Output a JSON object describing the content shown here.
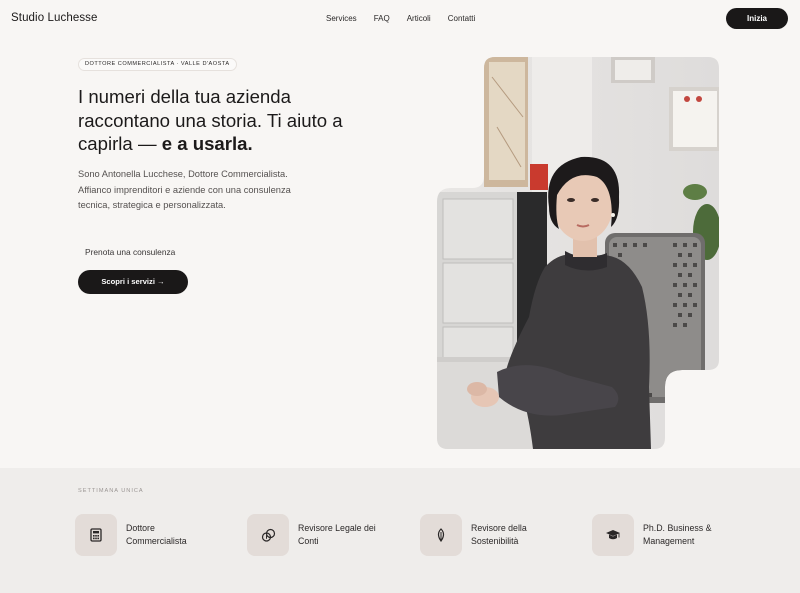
{
  "nav": {
    "brand": "Studio Luchesse",
    "links": [
      "Services",
      "FAQ",
      "Articoli",
      "Contatti"
    ],
    "cta_label": "Inizia"
  },
  "hero": {
    "badge": "DOTTORE COMMERCIALISTA · VALLE D'AOSTA",
    "headline_regular": "I numeri della tua azienda raccontano una storia. Ti aiuto a capirla — ",
    "headline_bold": "e a usarla.",
    "lead": "Sono Antonella Lucchese, Dottore Commercialista. Affianco imprenditori e aziende con una consulenza tecnica, strategica e personalizzata.",
    "consult_link": "Prenota una consulenza",
    "primary_button": "Scopri i servizi →"
  },
  "credentials": {
    "section_label": "SETTIMANA UNICA",
    "items": [
      {
        "label": "Dottore Commercialista",
        "icon": "calculator-icon"
      },
      {
        "label": "Revisore Legale dei Conti",
        "icon": "coins-icon"
      },
      {
        "label": "Revisore della Sostenibilità",
        "icon": "leaf-icon"
      },
      {
        "label": "Ph.D. Business & Management",
        "icon": "graduation-cap-icon"
      }
    ]
  },
  "colors": {
    "background": "#f8f6f4",
    "dark": "#1a1818",
    "band": "#efedeb",
    "icon_tile": "#e3dcd8"
  }
}
